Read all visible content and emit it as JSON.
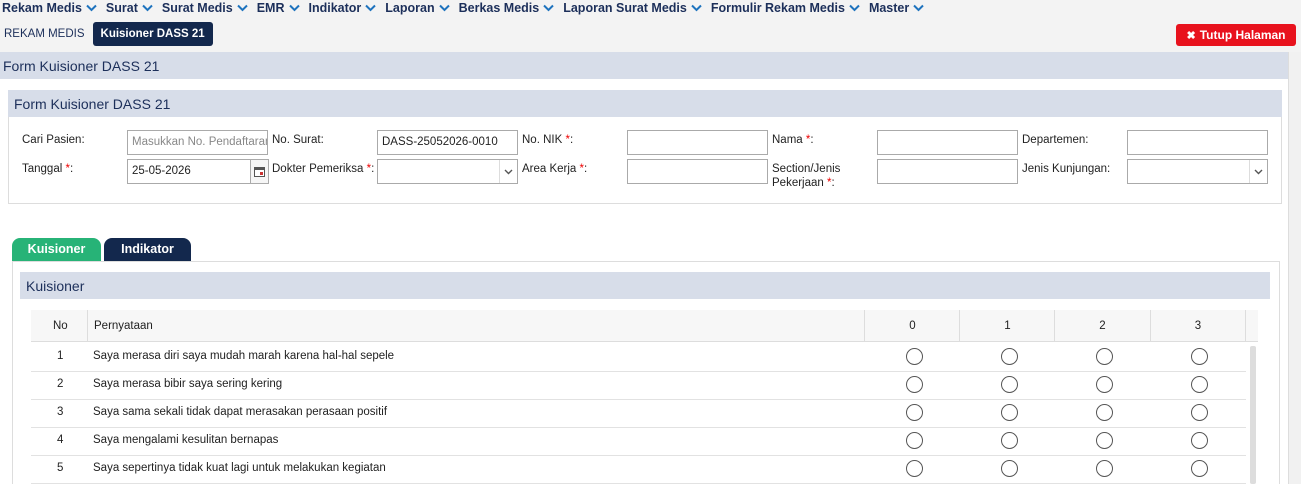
{
  "menu": [
    {
      "label": "Rekam Medis"
    },
    {
      "label": "Surat"
    },
    {
      "label": "Surat Medis"
    },
    {
      "label": "EMR"
    },
    {
      "label": "Indikator"
    },
    {
      "label": "Laporan"
    },
    {
      "label": "Berkas Medis"
    },
    {
      "label": "Laporan Surat Medis"
    },
    {
      "label": "Formulir Rekam Medis"
    },
    {
      "label": "Master"
    }
  ],
  "page_tabs": {
    "plain": "REKAM MEDIS",
    "active": "Kuisioner DASS 21"
  },
  "close_button": {
    "label": "Tutup Halaman"
  },
  "outer_title": "Form Kuisioner DASS 21",
  "form": {
    "title": "Form Kuisioner DASS 21",
    "cari_pasien": {
      "label": "Cari Pasien:",
      "placeholder": "Masukkan No. Pendaftaran"
    },
    "no_surat": {
      "label": "No. Surat:",
      "value": "DASS-25052026-0010"
    },
    "no_nik": {
      "label": "No. NIK ",
      "req": "*",
      "suffix": ":"
    },
    "nama": {
      "label": "Nama ",
      "req": "*",
      "suffix": ":"
    },
    "departemen": {
      "label": "Departemen:"
    },
    "tanggal": {
      "label": "Tanggal ",
      "req": "*",
      "suffix": ":",
      "value": "25-05-2026"
    },
    "dokter": {
      "label": "Dokter Pemeriksa ",
      "req": "*",
      "suffix": ":"
    },
    "area_kerja": {
      "label": "Area Kerja ",
      "req": "*",
      "suffix": ":"
    },
    "section": {
      "label1": "Section/Jenis",
      "label2": "Pekerjaan ",
      "req": "*",
      "suffix": ":"
    },
    "jenis_kunjungan": {
      "label": "Jenis Kunjungan:"
    }
  },
  "section_tabs": {
    "kuisioner": "Kuisioner",
    "indikator": "Indikator"
  },
  "kuisioner": {
    "title": "Kuisioner",
    "columns": {
      "no": "No",
      "pernyataan": "Pernyataan",
      "s0": "0",
      "s1": "1",
      "s2": "2",
      "s3": "3"
    },
    "rows": [
      {
        "no": "1",
        "text": "Saya merasa diri saya mudah marah karena hal-hal sepele"
      },
      {
        "no": "2",
        "text": "Saya merasa bibir saya sering kering"
      },
      {
        "no": "3",
        "text": "Saya sama sekali tidak dapat merasakan perasaan positif"
      },
      {
        "no": "4",
        "text": "Saya mengalami kesulitan bernapas"
      },
      {
        "no": "5",
        "text": "Saya sepertinya tidak kuat lagi untuk melakukan kegiatan"
      }
    ]
  },
  "colors": {
    "navy": "#13284d",
    "green": "#27b377",
    "red": "#e8121d",
    "panel": "#d7dde9"
  }
}
